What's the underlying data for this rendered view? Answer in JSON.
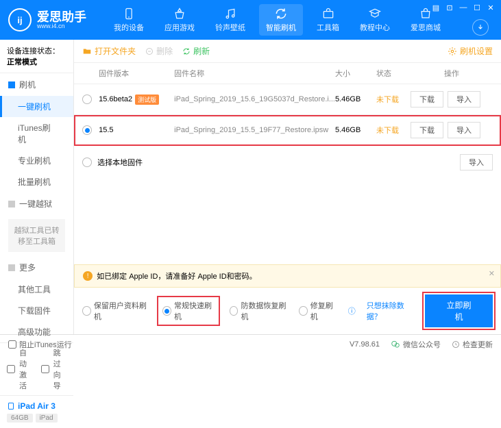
{
  "app": {
    "name": "爱思助手",
    "url": "www.i4.cn",
    "logoGlyph": "ij"
  },
  "topnav": [
    {
      "label": "我的设备"
    },
    {
      "label": "应用游戏"
    },
    {
      "label": "铃声壁纸"
    },
    {
      "label": "智能刷机"
    },
    {
      "label": "工具箱"
    },
    {
      "label": "教程中心"
    },
    {
      "label": "爱思商城"
    }
  ],
  "sidebar": {
    "connLabel": "设备连接状态：",
    "connValue": "正常模式",
    "group1": "刷机",
    "items1": [
      "一键刷机",
      "iTunes刷机",
      "专业刷机",
      "批量刷机"
    ],
    "group2": "一键越狱",
    "note": "越狱工具已转移至工具箱",
    "group3": "更多",
    "items3": [
      "其他工具",
      "下载固件",
      "高级功能"
    ],
    "autoActivate": "自动激活",
    "skipGuide": "跳过向导"
  },
  "device": {
    "name": "iPad Air 3",
    "storage": "64GB",
    "type": "iPad"
  },
  "toolbar": {
    "openFolder": "打开文件夹",
    "delete": "删除",
    "refresh": "刷新",
    "settings": "刷机设置"
  },
  "table": {
    "headers": {
      "version": "固件版本",
      "name": "固件名称",
      "size": "大小",
      "status": "状态",
      "ops": "操作"
    },
    "rows": [
      {
        "version": "15.6beta2",
        "badge": "测试版",
        "name": "iPad_Spring_2019_15.6_19G5037d_Restore.i...",
        "size": "5.46GB",
        "status": "未下载",
        "selected": false
      },
      {
        "version": "15.5",
        "badge": "",
        "name": "iPad_Spring_2019_15.5_19F77_Restore.ipsw",
        "size": "5.46GB",
        "status": "未下载",
        "selected": true
      }
    ],
    "localFirmware": "选择本地固件",
    "btnDownload": "下载",
    "btnImport": "导入"
  },
  "footer": {
    "warning": "如已绑定 Apple ID，请准备好 Apple ID和密码。",
    "opts": [
      "保留用户资料刷机",
      "常规快速刷机",
      "防数据恢复刷机",
      "修复刷机"
    ],
    "clearLink": "只想抹除数据？",
    "flashBtn": "立即刷机"
  },
  "statusbar": {
    "blockItunes": "阻止iTunes运行",
    "version": "V7.98.61",
    "wechat": "微信公众号",
    "checkUpdate": "检查更新"
  }
}
